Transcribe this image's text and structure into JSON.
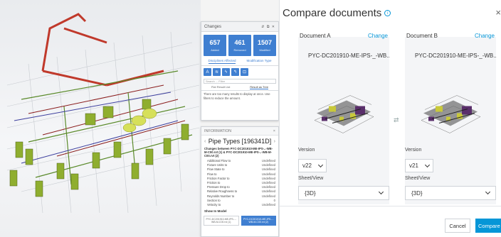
{
  "changes_panel": {
    "title": "Changes",
    "controls": "⇵ ⧉ ✕",
    "stats": [
      {
        "value": "657",
        "label": "Added"
      },
      {
        "value": "461",
        "label": "Removed"
      },
      {
        "value": "1507",
        "label": "Modified"
      }
    ],
    "tabs": [
      "Disciplines Affected",
      "Modification Type"
    ],
    "filter_placeholder": "Search ... Filter",
    "view_tabs": [
      "Flat Result List",
      "Result as Tree"
    ],
    "message": "There are too many results to display at once. Use filters to reduce the amount."
  },
  "info_panel": {
    "header": "INFORMATION",
    "title": "Pipe Types [196341D]",
    "subtitle": "Changes between PYC-DC201910-ME-IPS-..-WB-M-C00.rvt (1) & PYC-DC201910-ME-IPS-..-WB-M-C00.rvt (2)",
    "properties": [
      {
        "name": "Additional Flow to",
        "value": "Undefined"
      },
      {
        "name": "Fixture Units to",
        "value": "Undefined"
      },
      {
        "name": "Flow State to",
        "value": "Undefined"
      },
      {
        "name": "Flow to",
        "value": "Undefined"
      },
      {
        "name": "Friction Factor to",
        "value": "Undefined"
      },
      {
        "name": "Friction to",
        "value": "Undefined"
      },
      {
        "name": "Pressure Drop to",
        "value": "Undefined"
      },
      {
        "name": "Relative Roughness to",
        "value": "Undefined"
      },
      {
        "name": "Reynolds Number to",
        "value": "Undefined"
      },
      {
        "name": "Section to",
        "value": "0"
      },
      {
        "name": "Velocity to",
        "value": "Undefined"
      }
    ],
    "show_in_model": "Show In Model",
    "versions": [
      "PYC-DC201910-ME-IPS-..-WB-M-C00.rvt (1)",
      "PYC-DC201910-ME-IPS-..-WB-M-C00.rvt (2)"
    ]
  },
  "dialog": {
    "title": "Compare documents",
    "doc_a": {
      "label": "Document A",
      "change": "Change",
      "name": "PYC-DC201910-ME-IPS-_-WB..",
      "version_label": "Version",
      "version": "v22",
      "sheet_label": "Sheet/View",
      "sheet": "{3D}"
    },
    "doc_b": {
      "label": "Document B",
      "change": "Change",
      "name": "PYC-DC201910-ME-IPS-_-WB..",
      "version_label": "Version",
      "version": "v21",
      "sheet_label": "Sheet/View",
      "sheet": "{3D}"
    },
    "cancel": "Cancel",
    "compare": "Compare"
  },
  "colors": {
    "accent": "#0696d7",
    "stat_blue": "#3f7fd1",
    "pipe_red": "#c0392b",
    "equipment_green": "#8fae2f"
  }
}
